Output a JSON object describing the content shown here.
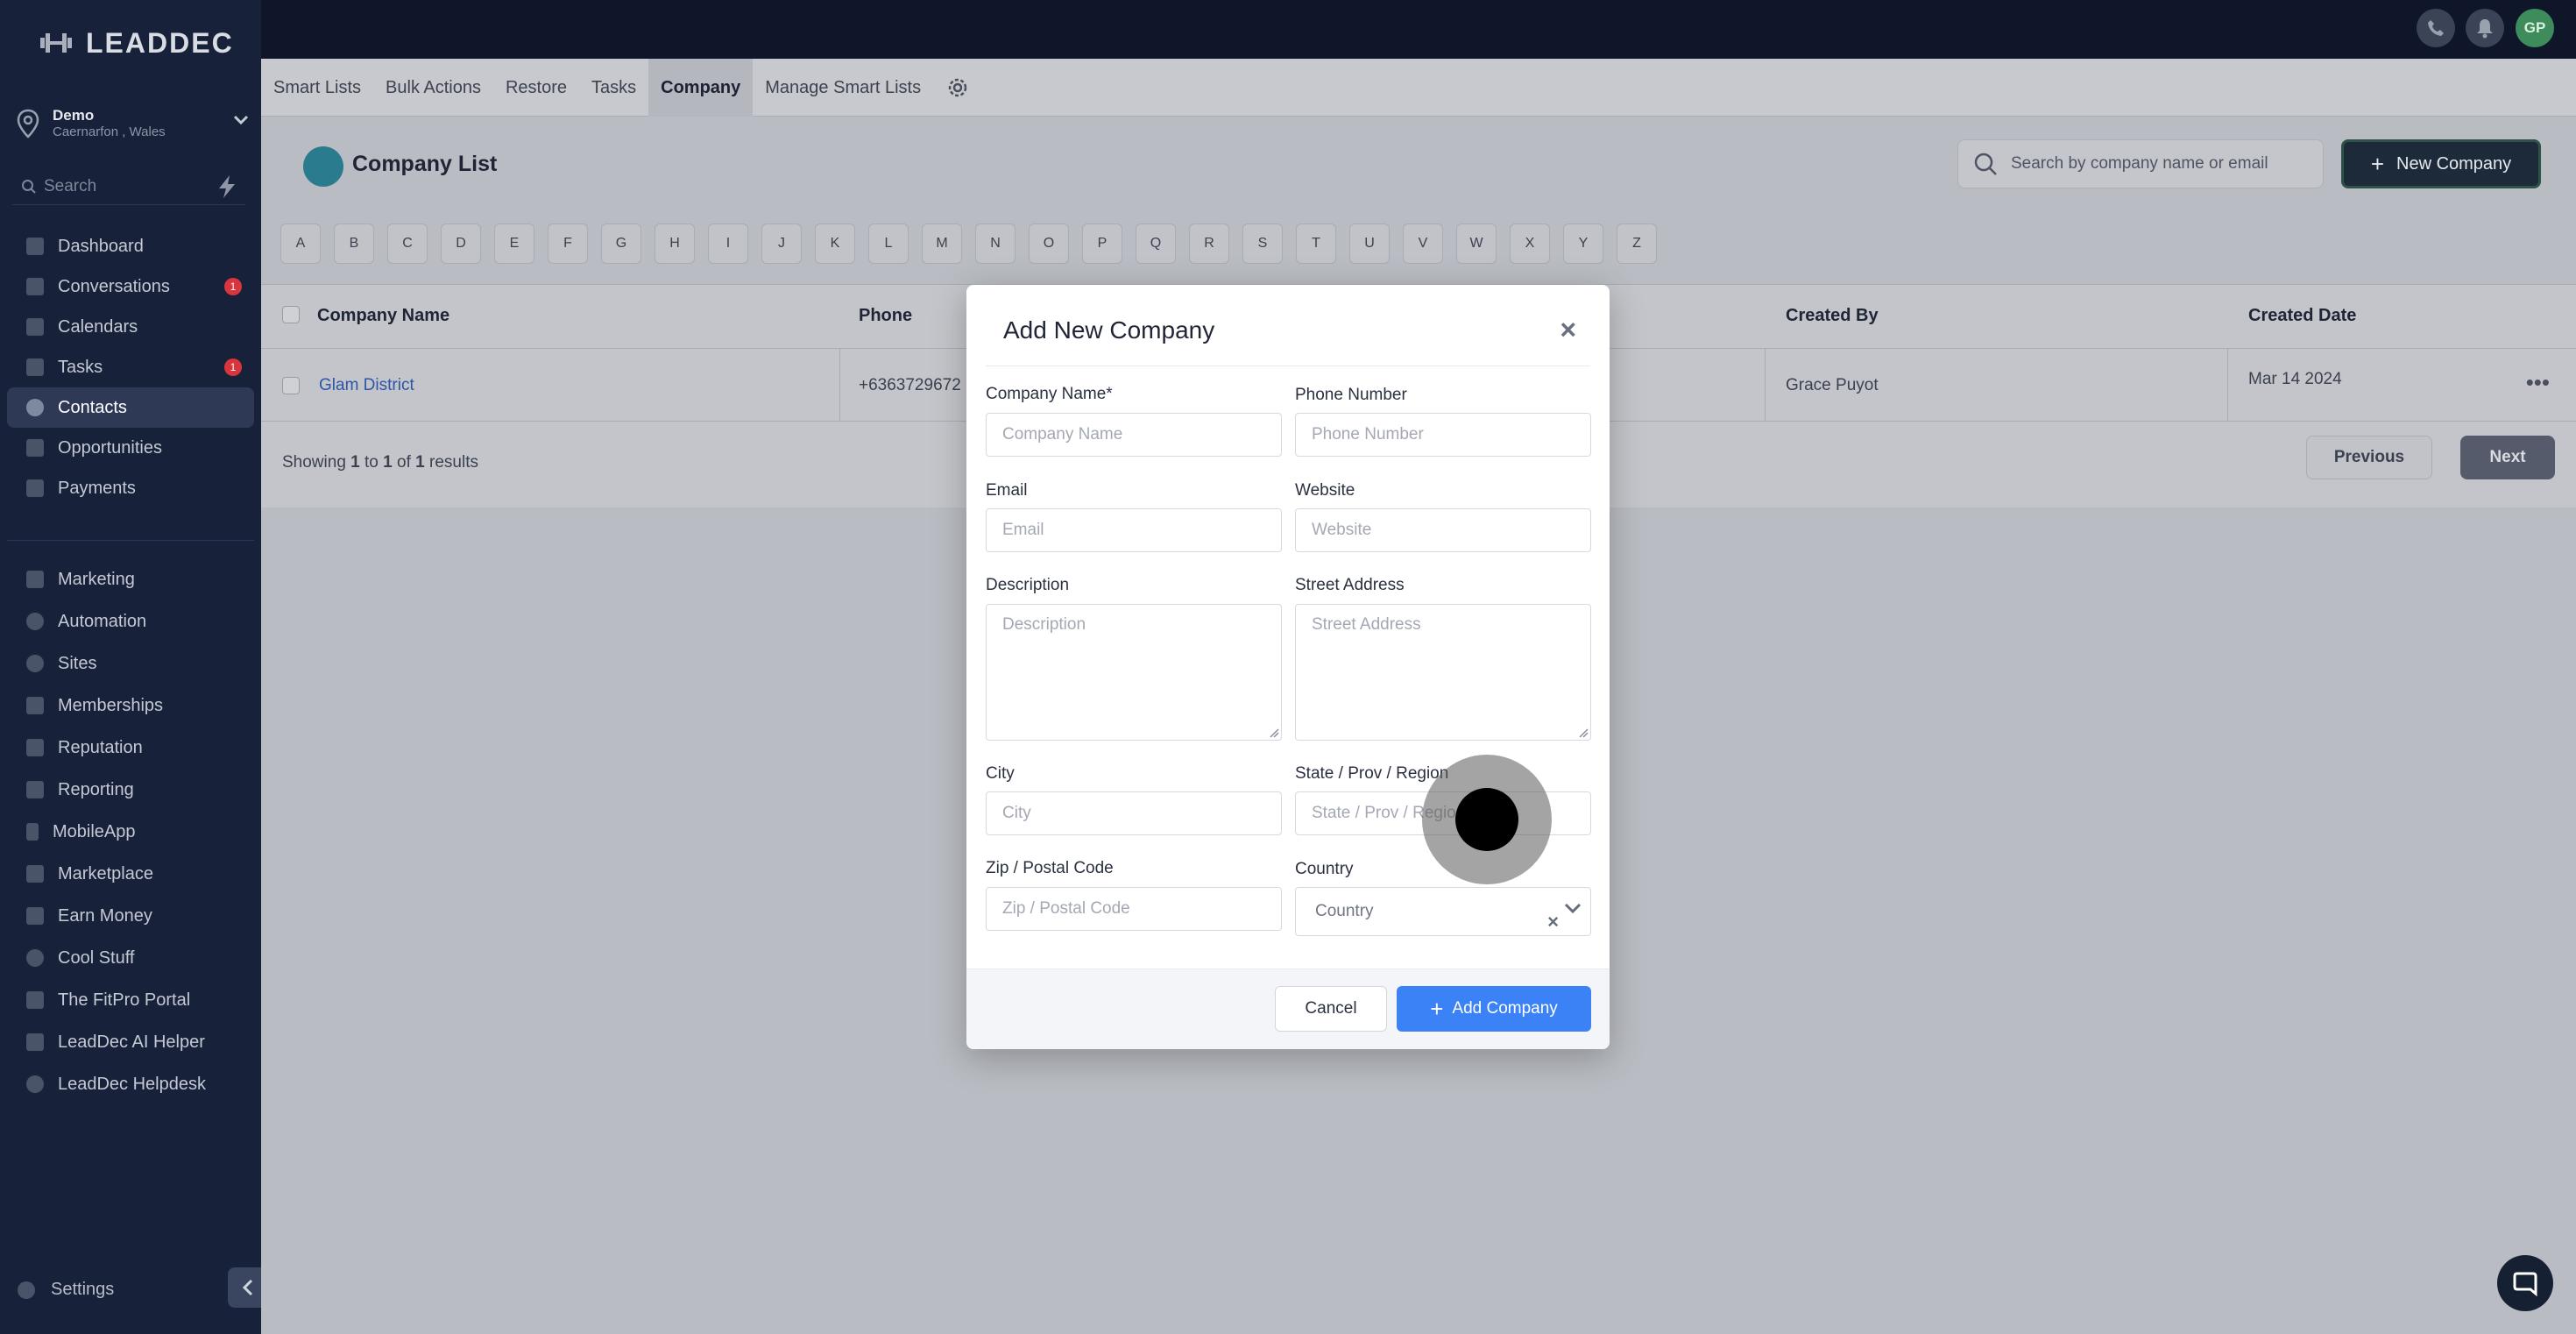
{
  "brand": {
    "name": "LEADDEC"
  },
  "location": {
    "name": "Demo",
    "sub": "Caernarfon , Wales"
  },
  "sidebar": {
    "search_placeholder": "Search",
    "items": [
      {
        "label": "Dashboard",
        "badge": ""
      },
      {
        "label": "Conversations",
        "badge": "1"
      },
      {
        "label": "Calendars",
        "badge": ""
      },
      {
        "label": "Tasks",
        "badge": "1"
      },
      {
        "label": "Contacts",
        "badge": ""
      },
      {
        "label": "Opportunities",
        "badge": ""
      },
      {
        "label": "Payments",
        "badge": ""
      }
    ],
    "items2": [
      {
        "label": "Marketing"
      },
      {
        "label": "Automation"
      },
      {
        "label": "Sites"
      },
      {
        "label": "Memberships"
      },
      {
        "label": "Reputation"
      },
      {
        "label": "Reporting"
      },
      {
        "label": "MobileApp"
      },
      {
        "label": "Marketplace"
      },
      {
        "label": "Earn Money"
      },
      {
        "label": "Cool Stuff"
      },
      {
        "label": "The FitPro Portal"
      },
      {
        "label": "LeadDec AI Helper"
      },
      {
        "label": "LeadDec Helpdesk"
      }
    ],
    "settings_label": "Settings"
  },
  "topbar": {
    "avatar_initials": "GP"
  },
  "tabs": [
    "Smart Lists",
    "Bulk Actions",
    "Restore",
    "Tasks",
    "Company",
    "Manage Smart Lists"
  ],
  "page": {
    "title": "Company List",
    "search_placeholder": "Search by company name or email",
    "new_button": "New Company"
  },
  "alphabet": [
    "A",
    "B",
    "C",
    "D",
    "E",
    "F",
    "G",
    "H",
    "I",
    "J",
    "K",
    "L",
    "M",
    "N",
    "O",
    "P",
    "Q",
    "R",
    "S",
    "T",
    "U",
    "V",
    "W",
    "X",
    "Y",
    "Z"
  ],
  "table": {
    "headers": {
      "name": "Company Name",
      "phone": "Phone",
      "created_by": "Created By",
      "created_date": "Created Date"
    },
    "rows": [
      {
        "name": "Glam District",
        "phone": "+6363729672",
        "created_by": "Grace Puyot",
        "created_date": "Mar 14 2024"
      }
    ],
    "showing": {
      "prefix": "Showing",
      "from": "1",
      "to_word": "to",
      "to": "1",
      "of_word": "of",
      "total": "1",
      "suffix": "results"
    },
    "prev": "Previous",
    "next": "Next"
  },
  "modal": {
    "title": "Add New Company",
    "close": "×",
    "fields": {
      "company_name": {
        "label": "Company Name*",
        "placeholder": "Company Name"
      },
      "phone": {
        "label": "Phone Number",
        "placeholder": "Phone Number"
      },
      "email": {
        "label": "Email",
        "placeholder": "Email"
      },
      "website": {
        "label": "Website",
        "placeholder": "Website"
      },
      "description": {
        "label": "Description",
        "placeholder": "Description"
      },
      "street": {
        "label": "Street Address",
        "placeholder": "Street Address"
      },
      "city": {
        "label": "City",
        "placeholder": "City"
      },
      "state": {
        "label": "State / Prov / Region",
        "placeholder": "State / Prov / Region"
      },
      "zip": {
        "label": "Zip / Postal Code",
        "placeholder": "Zip / Postal Code"
      },
      "country": {
        "label": "Country",
        "value": "Country",
        "clear": "×"
      }
    },
    "cancel": "Cancel",
    "submit": "Add Company"
  },
  "colors": {
    "accent": "#3b82f6",
    "sidebar_bg": "#17213a",
    "badge": "#d9353c"
  }
}
